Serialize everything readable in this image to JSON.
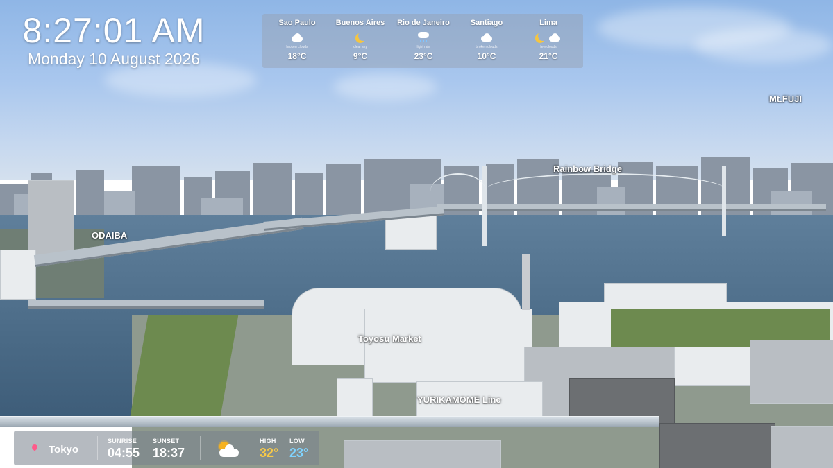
{
  "clock": {
    "time": "8:27:01 AM",
    "date": "Monday 10 August 2026"
  },
  "weather_strip": {
    "cities": [
      {
        "name": "Sao Paulo",
        "icon": "cloud-icon",
        "condition": "broken clouds",
        "temp": "18°C"
      },
      {
        "name": "Buenos Aires",
        "icon": "moon-icon",
        "condition": "clear sky",
        "temp": "9°C"
      },
      {
        "name": "Rio de Janeiro",
        "icon": "rain-icon",
        "condition": "light rain",
        "temp": "23°C"
      },
      {
        "name": "Santiago",
        "icon": "cloud-icon",
        "condition": "broken clouds",
        "temp": "10°C"
      },
      {
        "name": "Lima",
        "icon": "moon-cloud-icon",
        "condition": "few clouds",
        "temp": "21°C"
      }
    ]
  },
  "labels": {
    "mt_fuji": "Mt.FUJI",
    "rainbow_bridge": "Rainbow Bridge",
    "odaiba": "ODAIBA",
    "toyosu_market": "Toyosu Market",
    "yurikamome": "YURIKAMOME Line"
  },
  "bottom_bar": {
    "city": "Tokyo",
    "sunrise_label": "SUNRISE",
    "sunrise": "04:55",
    "sunset_label": "SUNSET",
    "sunset": "18:37",
    "high_label": "HIGH",
    "high": "32°",
    "low_label": "LOW",
    "low": "23°",
    "high_color": "#f7c948",
    "low_color": "#7fd3ff",
    "weather_icon": "sun-behind-cloud-icon"
  }
}
